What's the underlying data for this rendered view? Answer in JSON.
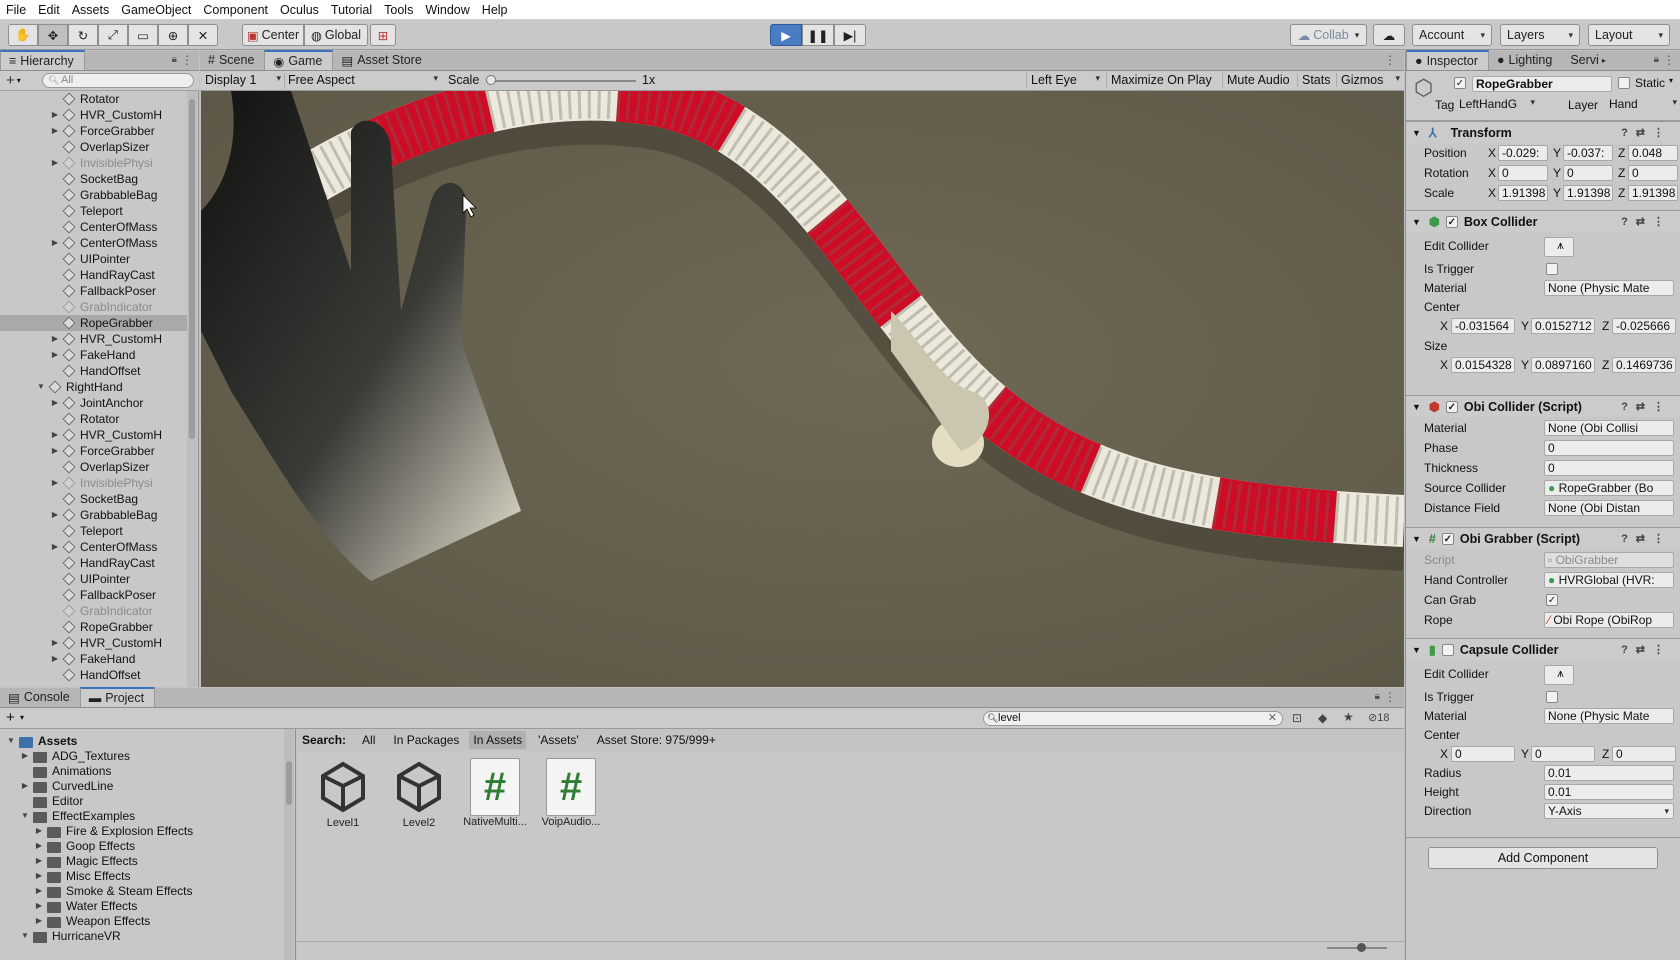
{
  "menu": [
    "File",
    "Edit",
    "Assets",
    "GameObject",
    "Component",
    "Oculus",
    "Tutorial",
    "Tools",
    "Window",
    "Help"
  ],
  "toolbar": {
    "pivot": "Center",
    "space": "Global",
    "collab": "Collab",
    "account": "Account",
    "layers": "Layers",
    "layout": "Layout"
  },
  "hierarchy": {
    "tab": "Hierarchy",
    "search_placeholder": "All",
    "rows": [
      {
        "name": "Rotator",
        "indent": 3,
        "arrow": false,
        "dim": false
      },
      {
        "name": "HVR_CustomH",
        "indent": 3,
        "arrow": true,
        "dim": false
      },
      {
        "name": "ForceGrabber",
        "indent": 3,
        "arrow": true,
        "dim": false
      },
      {
        "name": "OverlapSizer",
        "indent": 3,
        "arrow": false,
        "dim": false
      },
      {
        "name": "InvisiblePhysi",
        "indent": 3,
        "arrow": true,
        "dim": true
      },
      {
        "name": "SocketBag",
        "indent": 3,
        "arrow": false,
        "dim": false
      },
      {
        "name": "GrabbableBag",
        "indent": 3,
        "arrow": false,
        "dim": false
      },
      {
        "name": "Teleport",
        "indent": 3,
        "arrow": false,
        "dim": false
      },
      {
        "name": "CenterOfMass",
        "indent": 3,
        "arrow": false,
        "dim": false
      },
      {
        "name": "CenterOfMass",
        "indent": 3,
        "arrow": true,
        "dim": false
      },
      {
        "name": "UIPointer",
        "indent": 3,
        "arrow": false,
        "dim": false
      },
      {
        "name": "HandRayCast",
        "indent": 3,
        "arrow": false,
        "dim": false
      },
      {
        "name": "FallbackPoser",
        "indent": 3,
        "arrow": false,
        "dim": false
      },
      {
        "name": "GrabIndicator",
        "indent": 3,
        "arrow": false,
        "dim": true
      },
      {
        "name": "RopeGrabber",
        "indent": 3,
        "arrow": false,
        "dim": false,
        "selected": true
      },
      {
        "name": "HVR_CustomH",
        "indent": 3,
        "arrow": true,
        "dim": false
      },
      {
        "name": "FakeHand",
        "indent": 3,
        "arrow": true,
        "dim": false
      },
      {
        "name": "HandOffset",
        "indent": 3,
        "arrow": false,
        "dim": false
      },
      {
        "name": "RightHand",
        "indent": 2,
        "arrow": true,
        "open": true,
        "dim": false
      },
      {
        "name": "JointAnchor",
        "indent": 3,
        "arrow": true,
        "dim": false
      },
      {
        "name": "Rotator",
        "indent": 3,
        "arrow": false,
        "dim": false
      },
      {
        "name": "HVR_CustomH",
        "indent": 3,
        "arrow": true,
        "dim": false
      },
      {
        "name": "ForceGrabber",
        "indent": 3,
        "arrow": true,
        "dim": false
      },
      {
        "name": "OverlapSizer",
        "indent": 3,
        "arrow": false,
        "dim": false
      },
      {
        "name": "InvisiblePhysi",
        "indent": 3,
        "arrow": true,
        "dim": true
      },
      {
        "name": "SocketBag",
        "indent": 3,
        "arrow": false,
        "dim": false
      },
      {
        "name": "GrabbableBag",
        "indent": 3,
        "arrow": true,
        "dim": false
      },
      {
        "name": "Teleport",
        "indent": 3,
        "arrow": false,
        "dim": false
      },
      {
        "name": "CenterOfMass",
        "indent": 3,
        "arrow": true,
        "dim": false
      },
      {
        "name": "HandRayCast",
        "indent": 3,
        "arrow": false,
        "dim": false
      },
      {
        "name": "UIPointer",
        "indent": 3,
        "arrow": false,
        "dim": false
      },
      {
        "name": "FallbackPoser",
        "indent": 3,
        "arrow": false,
        "dim": false
      },
      {
        "name": "GrabIndicator",
        "indent": 3,
        "arrow": false,
        "dim": true
      },
      {
        "name": "RopeGrabber",
        "indent": 3,
        "arrow": false,
        "dim": false
      },
      {
        "name": "HVR_CustomH",
        "indent": 3,
        "arrow": true,
        "dim": false
      },
      {
        "name": "FakeHand",
        "indent": 3,
        "arrow": true,
        "dim": false
      },
      {
        "name": "HandOffset",
        "indent": 3,
        "arrow": false,
        "dim": false
      }
    ]
  },
  "center_tabs": [
    "Scene",
    "Game",
    "Asset Store"
  ],
  "game_bar": {
    "display": "Display 1",
    "aspect": "Free Aspect",
    "scale_label": "Scale",
    "scale_value": "1x",
    "eye": "Left Eye",
    "maximize": "Maximize On Play",
    "mute": "Mute Audio",
    "stats": "Stats",
    "gizmos": "Gizmos"
  },
  "bottom_tabs": [
    "Console",
    "Project"
  ],
  "project": {
    "search_value": "level",
    "hidden_count": "18",
    "search_label": "Search:",
    "filters": [
      "All",
      "In Packages",
      "In Assets",
      "'Assets'",
      "Asset Store: 975/999+"
    ],
    "tree": [
      {
        "name": "Assets",
        "indent": 0,
        "open": true,
        "bold": true
      },
      {
        "name": "ADG_Textures",
        "indent": 1,
        "arrow": true
      },
      {
        "name": "Animations",
        "indent": 1,
        "arrow": false
      },
      {
        "name": "CurvedLine",
        "indent": 1,
        "arrow": true
      },
      {
        "name": "Editor",
        "indent": 1,
        "arrow": false
      },
      {
        "name": "EffectExamples",
        "indent": 1,
        "open": true
      },
      {
        "name": "Fire & Explosion Effects",
        "indent": 2,
        "arrow": true
      },
      {
        "name": "Goop Effects",
        "indent": 2,
        "arrow": true
      },
      {
        "name": "Magic Effects",
        "indent": 2,
        "arrow": true
      },
      {
        "name": "Misc Effects",
        "indent": 2,
        "arrow": true
      },
      {
        "name": "Smoke & Steam Effects",
        "indent": 2,
        "arrow": true
      },
      {
        "name": "Water Effects",
        "indent": 2,
        "arrow": true
      },
      {
        "name": "Weapon Effects",
        "indent": 2,
        "arrow": true
      },
      {
        "name": "HurricaneVR",
        "indent": 1,
        "open": true
      }
    ],
    "assets": [
      {
        "name": "Level1",
        "kind": "unity"
      },
      {
        "name": "Level2",
        "kind": "unity"
      },
      {
        "name": "NativeMulti...",
        "kind": "script"
      },
      {
        "name": "VoipAudio...",
        "kind": "script"
      }
    ]
  },
  "inspector": {
    "tabs": [
      "Inspector",
      "Lighting",
      "Servi"
    ],
    "object_name": "RopeGrabber",
    "static_label": "Static",
    "tag_label": "Tag",
    "tag_value": "LeftHandG",
    "layer_label": "Layer",
    "layer_value": "Hand",
    "transform": {
      "title": "Transform",
      "position": [
        "-0.029:",
        "-0.037:",
        "0.048"
      ],
      "rotation": [
        "0",
        "0",
        "0"
      ],
      "scale": [
        "1.91398",
        "1.91398",
        "1.91398"
      ],
      "labels": [
        "Position",
        "Rotation",
        "Scale"
      ]
    },
    "box_collider": {
      "title": "Box Collider",
      "edit": "Edit Collider",
      "trigger": "Is Trigger",
      "material_label": "Material",
      "material": "None (Physic Mate",
      "center_label": "Center",
      "center": [
        "-0.031564",
        "0.0152712",
        "-0.025666"
      ],
      "size_label": "Size",
      "size": [
        "0.0154328",
        "0.0897160",
        "0.1469736"
      ]
    },
    "obi_collider": {
      "title": "Obi Collider (Script)",
      "labels": [
        "Material",
        "Phase",
        "Thickness",
        "Source Collider",
        "Distance Field"
      ],
      "values": [
        "None (Obi Collisi",
        "0",
        "0",
        "RopeGrabber (Bo",
        "None (Obi Distan"
      ]
    },
    "obi_grabber": {
      "title": "Obi Grabber (Script)",
      "labels": [
        "Script",
        "Hand Controller",
        "Can Grab",
        "Rope"
      ],
      "values": [
        "ObiGrabber",
        "HVRGlobal (HVR:",
        "",
        "Obi Rope (ObiRop"
      ]
    },
    "capsule": {
      "title": "Capsule Collider",
      "edit": "Edit Collider",
      "trigger": "Is Trigger",
      "material_label": "Material",
      "material": "None (Physic Mate",
      "center_label": "Center",
      "center": [
        "0",
        "0",
        "0"
      ],
      "radius_label": "Radius",
      "radius": "0.01",
      "height_label": "Height",
      "height": "0.01",
      "direction_label": "Direction",
      "direction": "Y-Axis"
    },
    "add_component": "Add Component"
  },
  "colors": {
    "accent": "#3a72c0",
    "rope_red": "#c8102e",
    "rope_white": "#e8e4d8",
    "game_bg": "#6a6351"
  }
}
